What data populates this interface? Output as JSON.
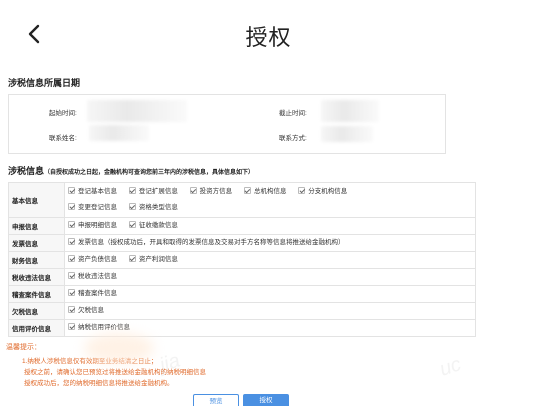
{
  "header": {
    "title": "授权"
  },
  "section1": {
    "title": "涉税信息所属日期",
    "fields": {
      "start_label": "起始时间:",
      "end_label": "截止时间:",
      "contact_name_label": "联系姓名:",
      "contact_method_label": "联系方式:"
    }
  },
  "section2": {
    "title": "涉税信息",
    "note": "（自授权成功之日起，金融机构可查询您前三年内的涉税信息，具体信息如下）",
    "rows": [
      {
        "category": "基本信息",
        "items": [
          "登记基本信息",
          "登记扩展信息",
          "投资方信息",
          "总机构信息",
          "分支机构信息",
          "变更登记信息",
          "资格类型信息"
        ]
      },
      {
        "category": "申报信息",
        "items": [
          "申报明细信息",
          "征收缴款信息"
        ]
      },
      {
        "category": "发票信息",
        "items": [
          "发票信息（授权成功后，开具和取得的发票信息及交易对手方名称等信息将推送给金融机构）"
        ]
      },
      {
        "category": "财务信息",
        "items": [
          "资产负债信息",
          "资产利润信息"
        ]
      },
      {
        "category": "税收违法信息",
        "items": [
          "税收违法信息"
        ]
      },
      {
        "category": "稽查案件信息",
        "items": [
          "稽查案件信息"
        ]
      },
      {
        "category": "欠税信息",
        "items": [
          "欠税信息"
        ]
      },
      {
        "category": "信用评价信息",
        "items": [
          "纳税信用评价信息"
        ]
      }
    ]
  },
  "tips": {
    "title": "温馨提示：",
    "lines": [
      "1.纳税人涉税信息仅有效期至业务结清之日止；",
      "  授权之前，请确认您已预览过将推送给金融机构的纳税明细信息",
      "  授权成功后，您的纳税明细信息将推送给金融机构。"
    ]
  },
  "buttons": {
    "preview": "预览",
    "authorize": "授权"
  },
  "colors": {
    "accent": "#4a90e2",
    "tip": "#e06a2b",
    "border": "#e3e3e3"
  }
}
